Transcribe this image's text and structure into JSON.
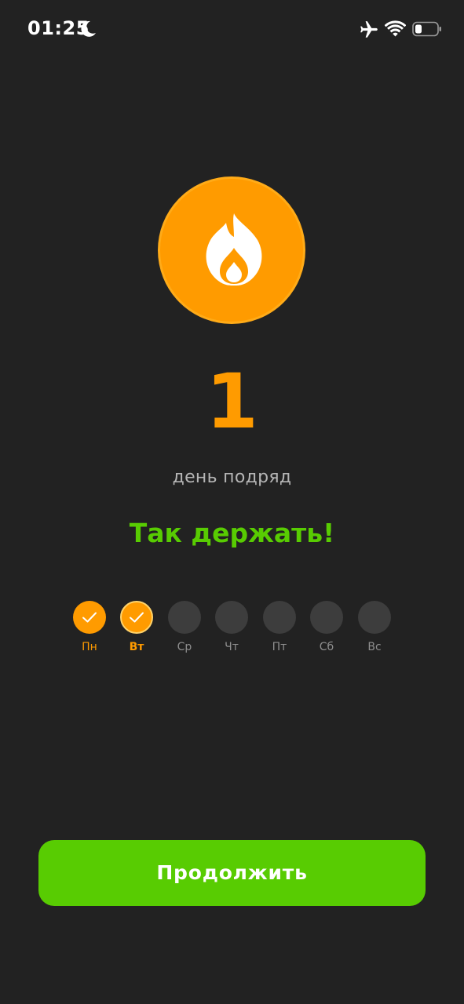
{
  "status_bar": {
    "time": "01:25",
    "icons": [
      "moon-icon",
      "airplane-icon",
      "wifi-icon",
      "battery-icon"
    ]
  },
  "streak": {
    "icon": "flame-icon",
    "count": "1",
    "label": "день подряд",
    "motivation": "Так держать!"
  },
  "week": {
    "days": [
      {
        "label": "Пн",
        "state": "done"
      },
      {
        "label": "Вт",
        "state": "today"
      },
      {
        "label": "Ср",
        "state": "empty"
      },
      {
        "label": "Чт",
        "state": "empty"
      },
      {
        "label": "Пт",
        "state": "empty"
      },
      {
        "label": "Сб",
        "state": "empty"
      },
      {
        "label": "Вс",
        "state": "empty"
      }
    ]
  },
  "actions": {
    "continue_label": "Продолжить"
  },
  "colors": {
    "background": "#222222",
    "accent_orange": "#ff9b00",
    "accent_green": "#58cc02",
    "inactive_day": "#3d3d3d",
    "muted_text": "#b5b5b5"
  }
}
